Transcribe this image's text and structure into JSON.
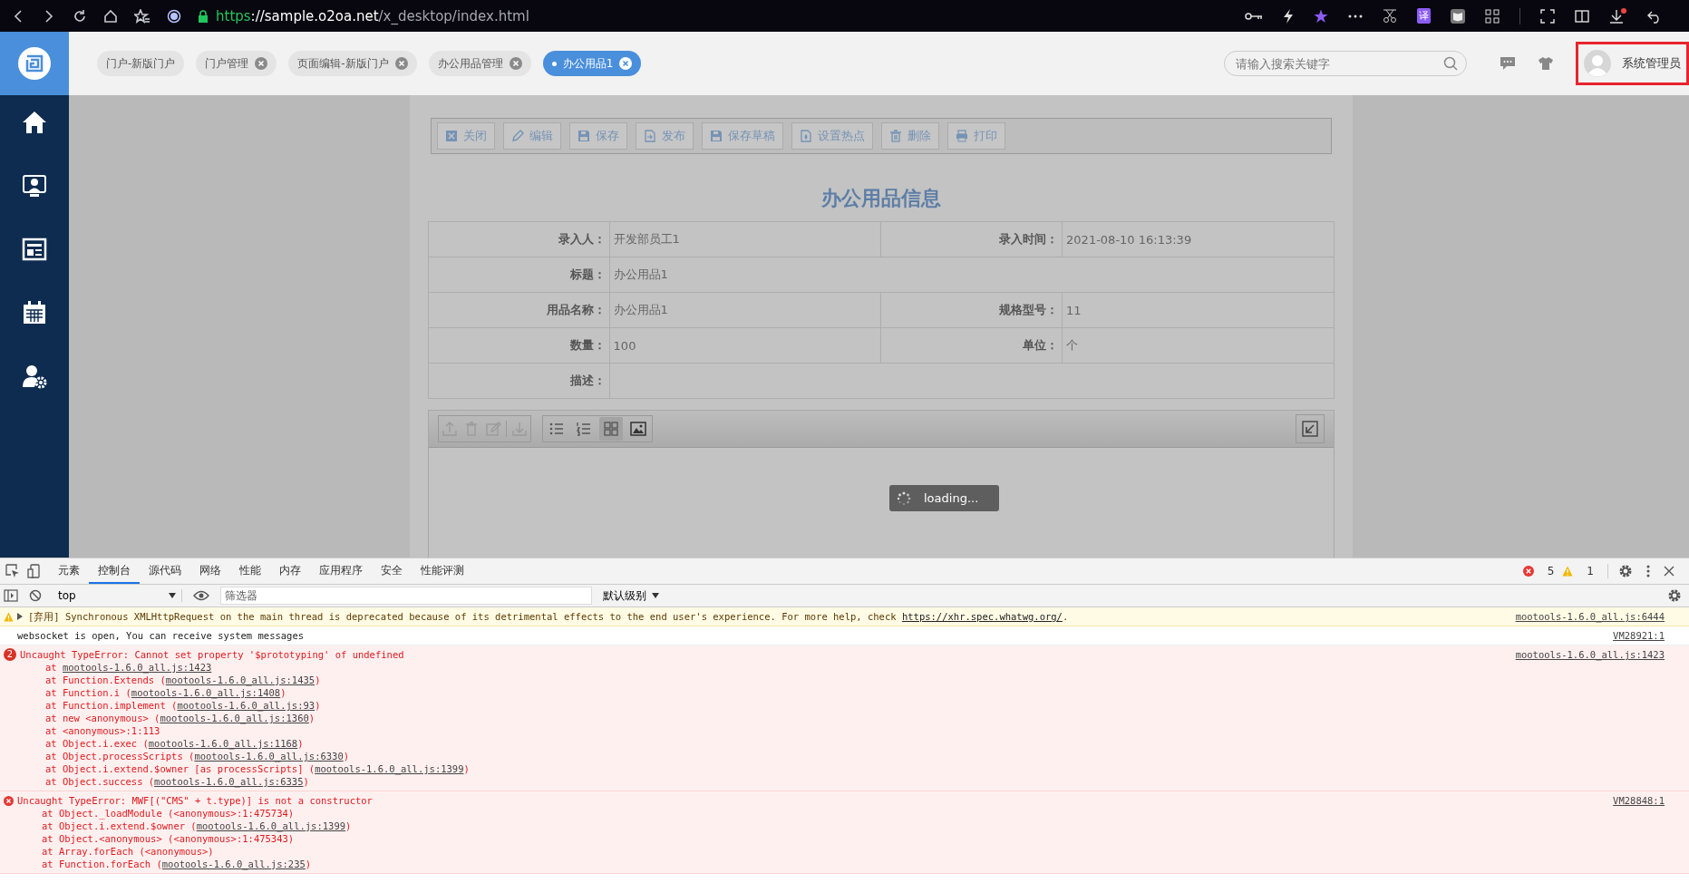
{
  "browser": {
    "url": [
      {
        "kind": "scheme",
        "text": "https"
      },
      {
        "kind": "host",
        "text": "://sample.o2oa.net"
      },
      {
        "kind": "path",
        "text": "/x_desktop/index.html"
      }
    ],
    "translate_label": "译"
  },
  "app": {
    "tabs": [
      {
        "label": "门户-新版门户",
        "closable": false,
        "selected": false
      },
      {
        "label": "门户管理",
        "closable": true,
        "selected": false
      },
      {
        "label": "页面编辑-新版门户",
        "closable": true,
        "selected": false
      },
      {
        "label": "办公用品管理",
        "closable": true,
        "selected": false
      },
      {
        "label": "办公用品1",
        "closable": true,
        "selected": true
      }
    ],
    "search": {
      "placeholder": "请输入搜索关键字"
    },
    "user": {
      "name": "系统管理员",
      "highlighted": true
    },
    "toolbar": [
      {
        "kind": "close",
        "label": "关闭"
      },
      {
        "kind": "edit",
        "label": "编辑"
      },
      {
        "kind": "save",
        "label": "保存"
      },
      {
        "kind": "publish",
        "label": "发布"
      },
      {
        "kind": "save",
        "label": "保存草稿"
      },
      {
        "kind": "hotspot",
        "label": "设置热点"
      },
      {
        "kind": "delete",
        "label": "删除"
      },
      {
        "kind": "print",
        "label": "打印"
      }
    ],
    "form": {
      "title": "办公用品信息",
      "rows": [
        [
          {
            "label": "录入人：",
            "value": "开发部员工1"
          },
          {
            "label": "录入时间：",
            "value": "2021-08-10 16:13:39"
          }
        ],
        [
          {
            "label": "标题：",
            "value": "办公用品1"
          }
        ],
        [
          {
            "label": "用品名称：",
            "value": "办公用品1"
          },
          {
            "label": "规格型号：",
            "value": "11"
          }
        ],
        [
          {
            "label": "数量：",
            "value": "100"
          },
          {
            "label": "单位：",
            "value": "个"
          }
        ],
        [
          {
            "label": "描述："
          }
        ]
      ]
    },
    "attachments": {
      "view_modes": [
        {
          "kind": "list",
          "selected": false
        },
        {
          "kind": "numbered",
          "selected": false
        },
        {
          "kind": "grid",
          "selected": true
        },
        {
          "kind": "image",
          "selected": false
        }
      ],
      "loading": "loading..."
    }
  },
  "devtools": {
    "tabs": [
      {
        "label": "元素",
        "selected": false
      },
      {
        "label": "控制台",
        "selected": true
      },
      {
        "label": "源代码",
        "selected": false
      },
      {
        "label": "网络",
        "selected": false
      },
      {
        "label": "性能",
        "selected": false
      },
      {
        "label": "内存",
        "selected": false
      },
      {
        "label": "应用程序",
        "selected": false
      },
      {
        "label": "安全",
        "selected": false
      },
      {
        "label": "性能评测",
        "selected": false
      }
    ],
    "error_count": "5",
    "warning_count": "1",
    "context": "top",
    "filter": {
      "placeholder": "筛选器"
    },
    "level": "默认级别",
    "messages": [
      {
        "kind": "warning",
        "text": "[弃用] Synchronous XMLHttpRequest on the main thread is deprecated because of its detrimental effects to the end user's experience. For more help, check ",
        "link": "https://xhr.spec.whatwg.org/",
        "suffix": ".",
        "source": "mootools-1.6.0_all.js:6444"
      },
      {
        "kind": "info",
        "text": "websocket is open, You can receive system messages",
        "source": "VM28921:1"
      },
      {
        "kind": "error",
        "repeat": "2",
        "text": "Uncaught TypeError: Cannot set property '$prototyping' of undefined",
        "source": "mootools-1.6.0_all.js:1423",
        "stack": [
          {
            "text": "at ",
            "link": "mootools-1.6.0_all.js:1423"
          },
          {
            "text": "at Function.Extends (",
            "link": "mootools-1.6.0_all.js:1435",
            "suffix": ")"
          },
          {
            "text": "at Function.i (",
            "link": "mootools-1.6.0_all.js:1408",
            "suffix": ")"
          },
          {
            "text": "at Function.implement (",
            "link": "mootools-1.6.0_all.js:93",
            "suffix": ")"
          },
          {
            "text": "at new <anonymous> (",
            "link": "mootools-1.6.0_all.js:1360",
            "suffix": ")"
          },
          {
            "text": "at <anonymous>:1:113"
          },
          {
            "text": "at Object.i.exec (",
            "link": "mootools-1.6.0_all.js:1168",
            "suffix": ")"
          },
          {
            "text": "at Object.processScripts (",
            "link": "mootools-1.6.0_all.js:6330",
            "suffix": ")"
          },
          {
            "text": "at Object.i.extend.$owner [as processScripts] (",
            "link": "mootools-1.6.0_all.js:1399",
            "suffix": ")"
          },
          {
            "text": "at Object.success (",
            "link": "mootools-1.6.0_all.js:6335",
            "suffix": ")"
          }
        ]
      },
      {
        "kind": "error",
        "text": "Uncaught TypeError: MWF[(\"CMS\" + t.type)] is not a constructor",
        "source": "VM28848:1",
        "stack": [
          {
            "text": "at Object._loadModule (<anonymous>:1:475734)"
          },
          {
            "text": "at Object.i.extend.$owner (",
            "link": "mootools-1.6.0_all.js:1399",
            "suffix": ")"
          },
          {
            "text": "at Object.<anonymous> (<anonymous>:1:475343)"
          },
          {
            "text": "at Array.forEach (<anonymous>)"
          },
          {
            "text": "at Function.forEach (",
            "link": "mootools-1.6.0_all.js:235",
            "suffix": ")"
          }
        ]
      }
    ]
  }
}
